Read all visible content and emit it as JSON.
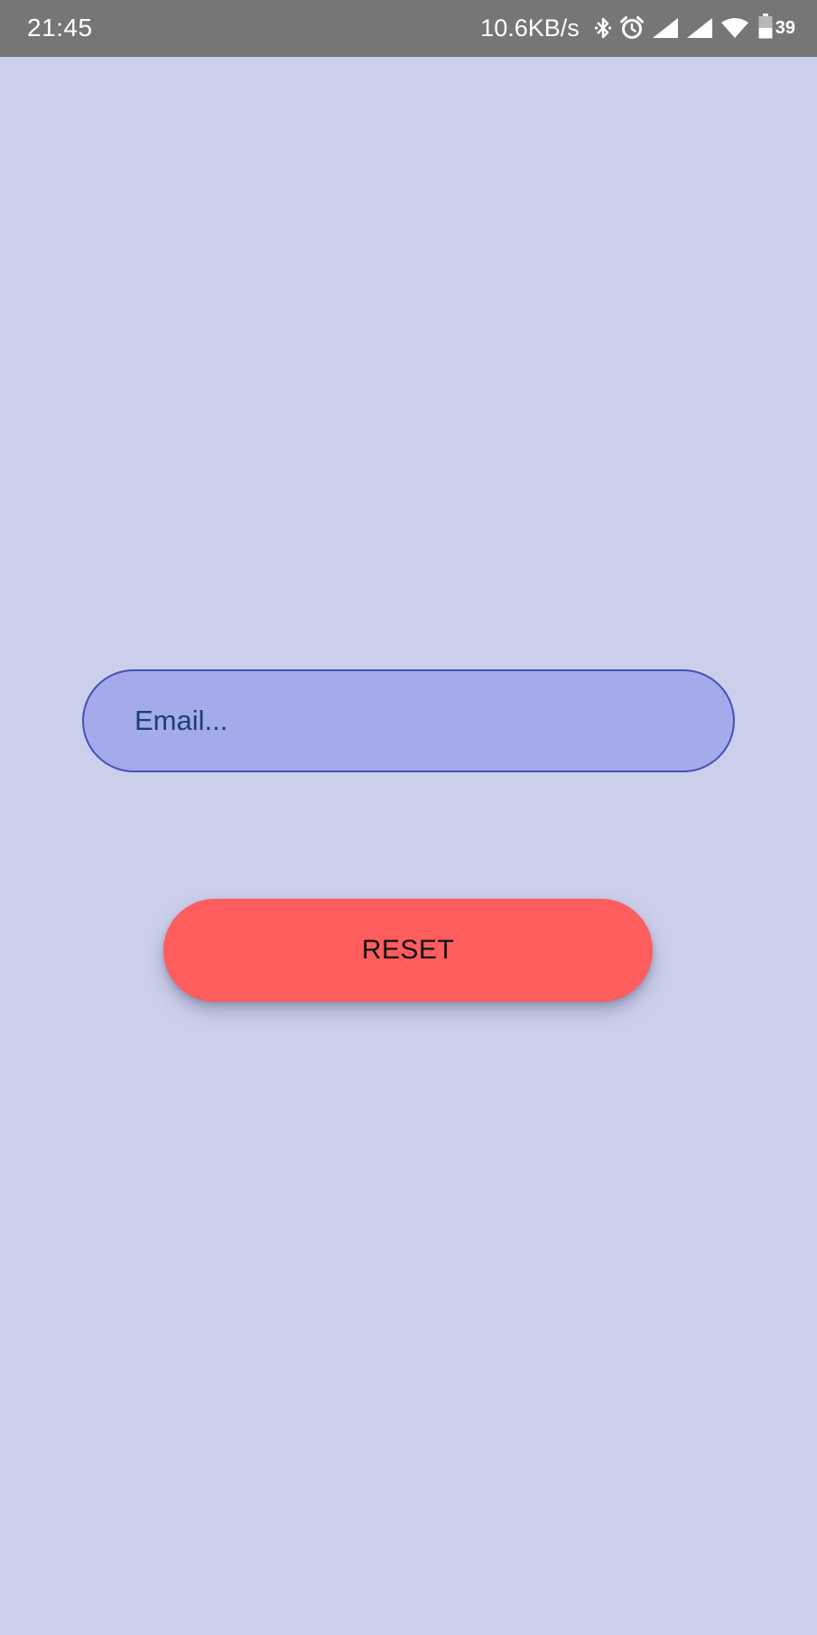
{
  "status_bar": {
    "time": "21:45",
    "net_speed": "10.6KB/s",
    "battery_percent": "39",
    "icons": [
      "bluetooth-icon",
      "alarm-icon",
      "signal-icon",
      "signal-icon",
      "wifi-icon",
      "battery-icon"
    ]
  },
  "form": {
    "email_placeholder": "Email...",
    "email_value": "",
    "reset_label": "RESET"
  },
  "colors": {
    "background": "#cbcfeb",
    "status_bar": "#767676",
    "input_fill": "#a3abea",
    "input_border": "#4651b8",
    "button_fill": "#fe5d5d"
  }
}
